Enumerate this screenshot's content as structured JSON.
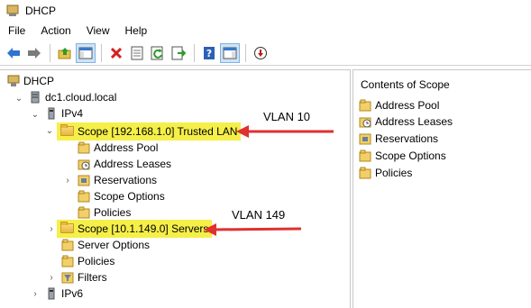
{
  "window": {
    "title": "DHCP"
  },
  "menu": {
    "items": [
      "File",
      "Action",
      "View",
      "Help"
    ]
  },
  "toolbar": {
    "buttons": [
      "back-icon",
      "forward-icon",
      "up-folder-icon",
      "show-hide-tree-icon",
      "delete-icon",
      "properties-icon",
      "refresh-icon",
      "export-list-icon",
      "help-icon",
      "show-action-pane-icon",
      "deactivate-icon"
    ]
  },
  "tree": {
    "root": "DHCP",
    "server": "dc1.cloud.local",
    "ipv4": "IPv4",
    "scope1": "Scope [192.168.1.0] Trusted LAN",
    "scope1_children": [
      "Address Pool",
      "Address Leases",
      "Reservations",
      "Scope Options",
      "Policies"
    ],
    "scope2": "Scope [10.1.149.0] Servers",
    "server_options": "Server Options",
    "policies": "Policies",
    "filters": "Filters",
    "ipv6": "IPv6"
  },
  "annotations": {
    "vlan1": "VLAN 10",
    "vlan2": "VLAN 149",
    "arrow_color": "#e03030",
    "highlight_color": "#f5ef4a"
  },
  "right_pane": {
    "header": "Contents of Scope",
    "items": [
      "Address Pool",
      "Address Leases",
      "Reservations",
      "Scope Options",
      "Policies"
    ]
  }
}
